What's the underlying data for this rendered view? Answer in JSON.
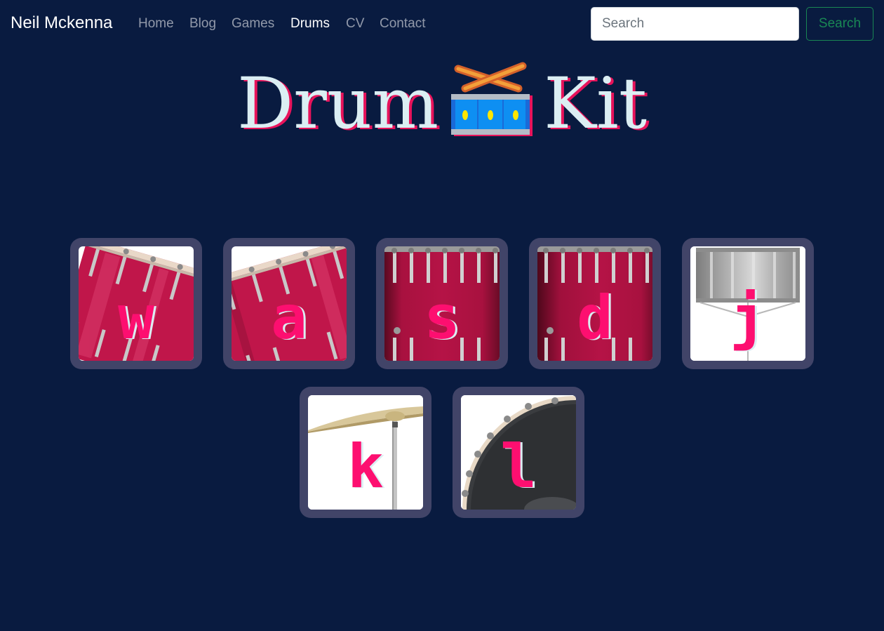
{
  "nav": {
    "brand": "Neil Mckenna",
    "links": [
      "Home",
      "Blog",
      "Games",
      "Drums",
      "CV",
      "Contact"
    ],
    "active": "Drums",
    "search_placeholder": "Search",
    "search_button": "Search"
  },
  "page": {
    "title_left": "Drum",
    "title_right": "Kit",
    "title_icon": "drum-emoji"
  },
  "colors": {
    "background": "#091b40",
    "pad_frame": "#414468",
    "letter": "#fd0f70",
    "title": "#dbeef3",
    "title_shadow": "#e8135b",
    "search_accent": "#198754"
  },
  "pads": [
    {
      "key": "w",
      "drum": "tom-1"
    },
    {
      "key": "a",
      "drum": "tom-2"
    },
    {
      "key": "s",
      "drum": "tom-3"
    },
    {
      "key": "d",
      "drum": "tom-4"
    },
    {
      "key": "j",
      "drum": "snare"
    },
    {
      "key": "k",
      "drum": "crash"
    },
    {
      "key": "l",
      "drum": "kick"
    }
  ]
}
